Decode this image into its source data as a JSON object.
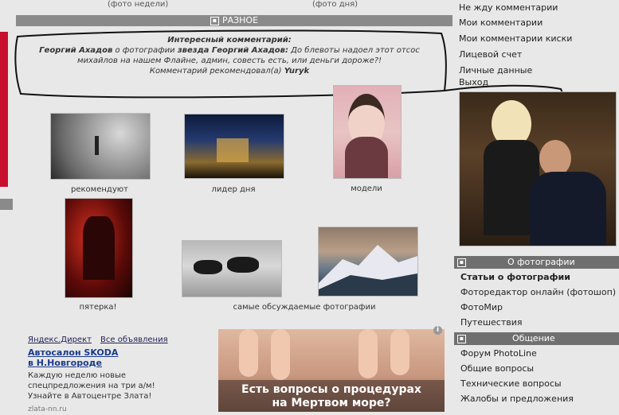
{
  "top_captions": {
    "week": "(фото недели)",
    "day": "(фото дня)"
  },
  "section": {
    "title": "РАЗНОЕ"
  },
  "comment": {
    "heading": "Интересный комментарий:",
    "author": "Георгий Ахадов",
    "middle": " о фотографии ",
    "target": "звезда Георгий Ахадов:",
    "text": " До блевоты надоел этот отсос михайлов на нашем Флайне, админ, совесть есть, или деньги дороже?!",
    "recommended_prefix": "Комментарий рекомендовал(а) ",
    "recommended_by": "Yuryk"
  },
  "thumbnails": [
    {
      "label": "рекомендуют"
    },
    {
      "label": "лидер дня"
    },
    {
      "label": "модели"
    },
    {
      "label": "пятерка!"
    },
    {
      "label": "самые обсуждаемые фотографии"
    },
    {
      "label": ""
    }
  ],
  "ad": {
    "source": "Яндекс.Директ",
    "all_ads": "Все объявления",
    "title_line1": "Автосалон SKODA",
    "title_line2": "в Н.Новгороде",
    "text": "Каждую неделю новые спецпредложения на три а/м! Узнайте в Автоцентре Злата!",
    "url": "zlata-nn.ru"
  },
  "banner": {
    "text_line1": "Есть вопросы о процедурах",
    "text_line2": "на Мертвом море?",
    "info": "i"
  },
  "side_menu": {
    "account_links": [
      "Не жду комментарии",
      "Мои комментарии",
      "Мои комментарии киски",
      "Лицевой счет",
      "Личные данные",
      "Выход"
    ],
    "about_photo": {
      "title": "О фотографии",
      "links": [
        "Статьи о фотографии",
        "Фото&редактор онлайн (фотошоп)",
        "ФотоМир",
        "Путешествия"
      ]
    },
    "communication": {
      "title": "Общение",
      "links": [
        "Форум PhotoLine",
        "Общие вопросы",
        "Технические вопросы",
        "Жалобы и предложения"
      ]
    }
  },
  "colors": {
    "section_bar": "#8a8a8a",
    "side_bar": "#6f6f6f",
    "ad_title": "#1a3a8a",
    "left_stripe": "#c8102e"
  }
}
